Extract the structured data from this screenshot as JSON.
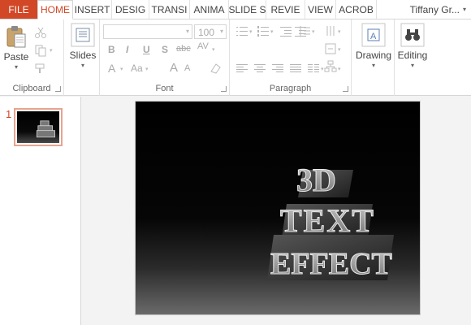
{
  "tabs": {
    "file": "FILE",
    "home": "HOME",
    "insert": "INSERT",
    "design": "DESIG",
    "transitions": "TRANSI",
    "animations": "ANIMA",
    "slideshow": "SLIDE S",
    "review": "REVIE",
    "view": "VIEW",
    "acrobat": "ACROB",
    "user": "Tiffany Gr..."
  },
  "clipboard": {
    "paste_label": "Paste",
    "group_label": "Clipboard"
  },
  "slides": {
    "new_slide_label": "Slides"
  },
  "font": {
    "font_name": "",
    "font_size": "100",
    "group_label": "Font",
    "bold": "B",
    "italic": "I",
    "underline": "U",
    "shadow": "S",
    "strike": "abc",
    "spacing": "AV",
    "font_color": "A",
    "change_case": "Aa",
    "grow": "A",
    "shrink": "A"
  },
  "paragraph": {
    "group_label": "Paragraph"
  },
  "drawing": {
    "label": "Drawing"
  },
  "editing": {
    "label": "Editing"
  },
  "slide_pane": {
    "slide_number": "1"
  },
  "slide": {
    "words": [
      "3D",
      "TEXT",
      "EFFECT"
    ]
  },
  "colors": {
    "accent": "#d24726",
    "thumb_border": "#e7a48e"
  }
}
